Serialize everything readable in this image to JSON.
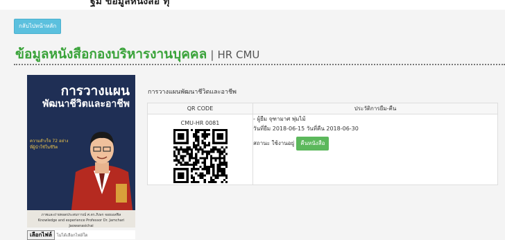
{
  "top": {
    "partial_text": "ฐม ข้อมูลหนังสือ ทุ"
  },
  "back_button": "กลับไปหน้าหลัก",
  "heading": {
    "title_th": "ข้อมูลหนังสือกองบริหารงานบุคคล",
    "separator": "|",
    "title_en": "HR CMU"
  },
  "cover": {
    "title_line1": "การวางแผน",
    "title_line2": "พัฒนาชีวิตและอาชีพ",
    "note_line1": "ความสำเร็จ 72 อย่าง",
    "note_line2": "ที่ผู้นำใช้ในชีวิต",
    "footer_line1": "ภาพและถ่ายทอดประสบการณ์ ศ.ดร.ภิเษก จอยเอลฟิล",
    "footer_line2": "Knowledge and experience Professor Dr. Jamchari Jaowanasichai"
  },
  "upload": {
    "button": "เลือกไฟล์",
    "status": "ไม่ได้เลือกไฟล์ใด"
  },
  "book_title": "การวางแผนพัฒนาชีวิตและอาชีพ",
  "table": {
    "col_qr": "QR CODE",
    "col_history": "ประวัติการยืม-คืน",
    "qr_code": "CMU-HR 0081",
    "borrower": "- ผู้ยืม จุฑามาศ พุ่มไม้",
    "dates": "วันที่ยืม 2018-06-15 วันที่คืน 2018-06-30",
    "status": "สถานะ ใช้งานอยู่",
    "return_button": "คืนหนังสือ"
  },
  "colors": {
    "accent_green": "#3aa33a",
    "info_blue": "#5bc0de",
    "success_green": "#5cb85c"
  }
}
